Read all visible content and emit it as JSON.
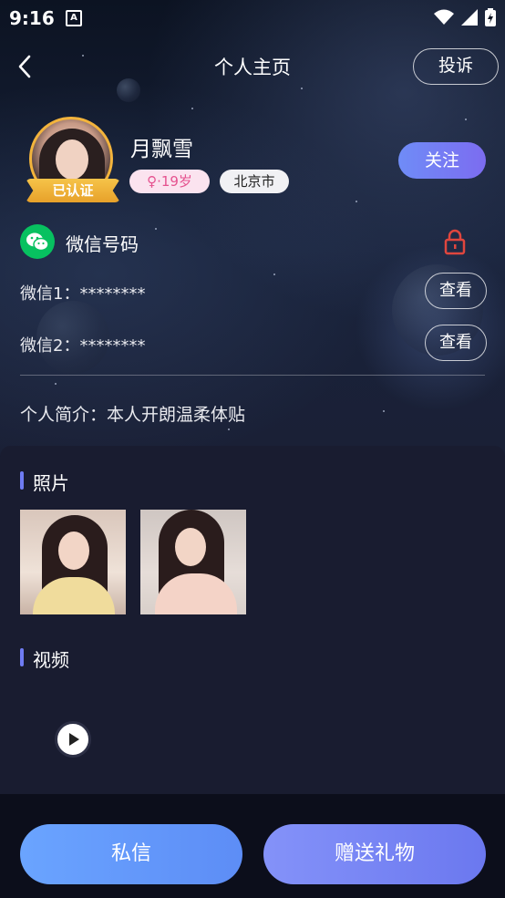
{
  "status_bar": {
    "time": "9:16",
    "app_icon": "A"
  },
  "nav": {
    "title": "个人主页",
    "report_label": "投诉"
  },
  "profile": {
    "name": "月飘雪",
    "verified_badge": "已认证",
    "age_tag": "♀·19岁",
    "city_tag": "北京市",
    "follow_label": "关注"
  },
  "wechat": {
    "title": "微信号码",
    "entries": [
      {
        "label": "微信1：********",
        "action": "查看"
      },
      {
        "label": "微信2：********",
        "action": "查看"
      }
    ]
  },
  "intro": {
    "text": "个人简介：本人开朗温柔体贴"
  },
  "photos": {
    "title": "照片",
    "count": 2
  },
  "videos": {
    "title": "视频"
  },
  "actions": {
    "message_label": "私信",
    "gift_label": "赠送礼物"
  },
  "colors": {
    "accent": "#6f7cf3",
    "female": "#e5528f",
    "badge": "#f3b43c",
    "wechat": "#07c160"
  }
}
